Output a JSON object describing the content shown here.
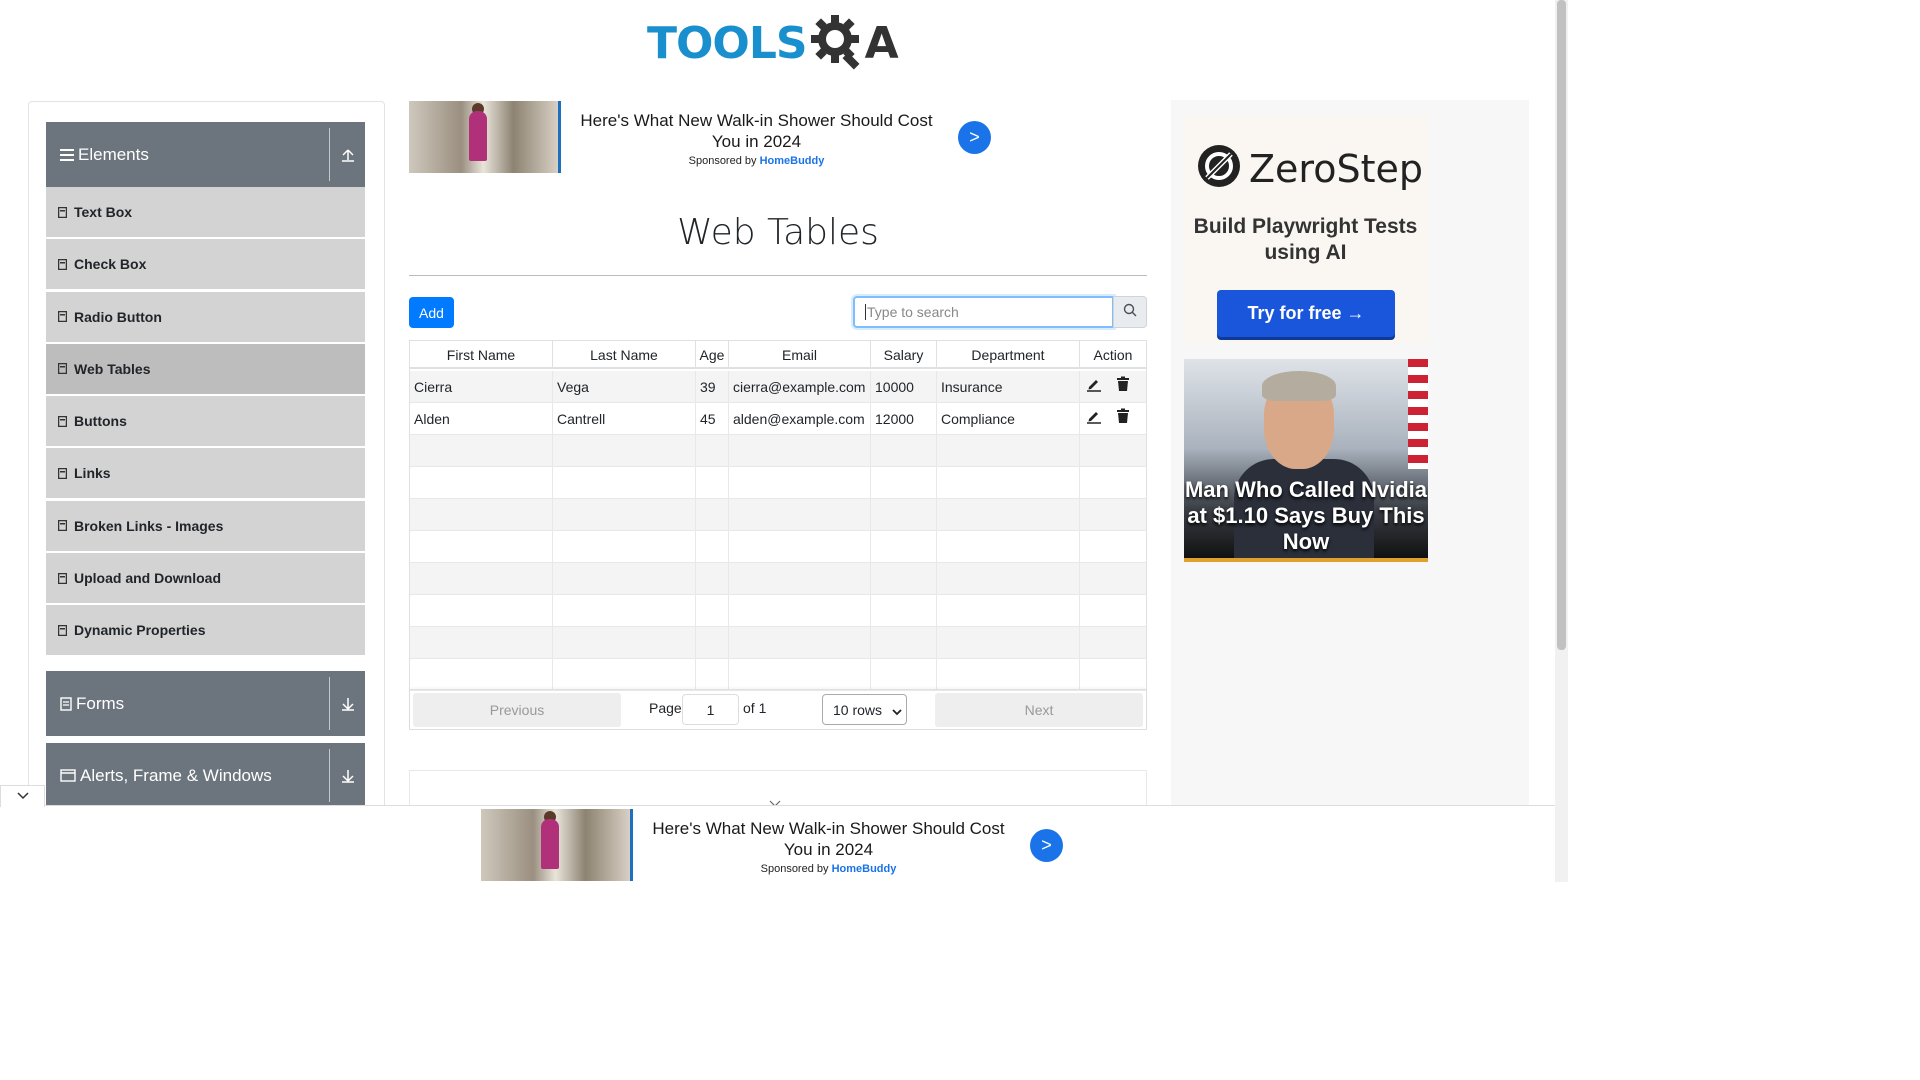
{
  "header": {
    "logo_text_left": "TOOLS",
    "logo_text_right": "A"
  },
  "sidebar": {
    "groups": [
      {
        "title": "Elements"
      },
      {
        "title": "Forms"
      },
      {
        "title": "Alerts, Frame & Windows"
      }
    ],
    "items": [
      {
        "label": "Text Box"
      },
      {
        "label": "Check Box"
      },
      {
        "label": "Radio Button"
      },
      {
        "label": "Web Tables"
      },
      {
        "label": "Buttons"
      },
      {
        "label": "Links"
      },
      {
        "label": "Broken Links - Images"
      },
      {
        "label": "Upload and Download"
      },
      {
        "label": "Dynamic Properties"
      }
    ]
  },
  "top_ad": {
    "headline": "Here's What New Walk-in Shower Should Cost You in 2024",
    "sponsored_prefix": "Sponsored by",
    "sponsor": "HomeBuddy",
    "cta": ">"
  },
  "main": {
    "title": "Web Tables",
    "add_label": "Add",
    "search_placeholder": "Type to search",
    "columns": [
      "First Name",
      "Last Name",
      "Age",
      "Email",
      "Salary",
      "Department",
      "Action"
    ],
    "rows": [
      {
        "first": "Cierra",
        "last": "Vega",
        "age": "39",
        "email": "cierra@example.com",
        "salary": "10000",
        "dept": "Insurance"
      },
      {
        "first": "Alden",
        "last": "Cantrell",
        "age": "45",
        "email": "alden@example.com",
        "salary": "12000",
        "dept": "Compliance"
      }
    ],
    "pagination": {
      "previous": "Previous",
      "next": "Next",
      "page_label": "Page",
      "page_value": "1",
      "of_label": "of 1",
      "rows_select": "10 rows"
    }
  },
  "right_ad": {
    "brand": "ZeroStep",
    "subtitle": "Build Playwright Tests using AI",
    "cta": "Try for free →",
    "promo_text": "Man Who Called Nvidia at $1.10 Says Buy This Now"
  },
  "bottom_ad": {
    "headline": "Here's What New Walk-in Shower Should Cost You in 2024",
    "sponsored_prefix": "Sponsored by",
    "sponsor": "HomeBuddy",
    "cta": ">"
  },
  "colors": {
    "accent": "#007bff",
    "sidebar_header": "#6c757d",
    "sidebar_item": "#d3d3d3",
    "logo_blue": "#1a8fce"
  }
}
